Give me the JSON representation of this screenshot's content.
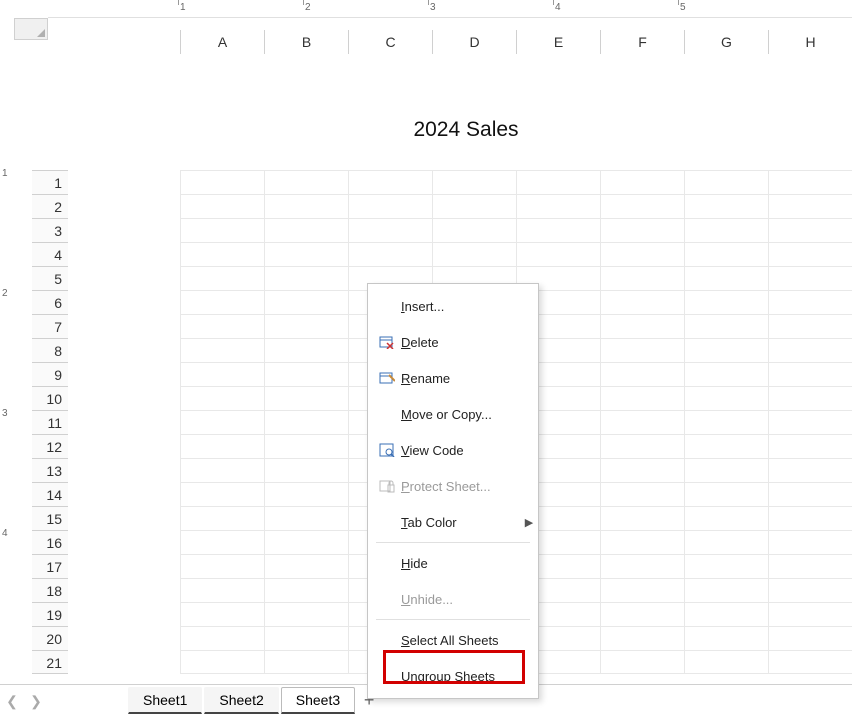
{
  "ruler": {
    "h": [
      1,
      2,
      3,
      4,
      5
    ],
    "v": [
      1,
      2,
      3,
      4
    ]
  },
  "columns": [
    "A",
    "B",
    "C",
    "D",
    "E",
    "F",
    "G",
    "H"
  ],
  "rows": [
    1,
    2,
    3,
    4,
    5,
    6,
    7,
    8,
    9,
    10,
    11,
    12,
    13,
    14,
    15,
    16,
    17,
    18,
    19,
    20,
    21
  ],
  "header_title": "2024 Sales",
  "tabs": [
    "Sheet1",
    "Sheet2",
    "Sheet3"
  ],
  "active_tab": 2,
  "menu": {
    "insert": "Insert...",
    "delete": "Delete",
    "rename": "Rename",
    "move": "Move or Copy...",
    "view_code": "View Code",
    "protect": "Protect Sheet...",
    "tab_color": "Tab Color",
    "hide": "Hide",
    "unhide": "Unhide...",
    "select_all": "Select All Sheets",
    "ungroup": "Ungroup Sheets"
  }
}
